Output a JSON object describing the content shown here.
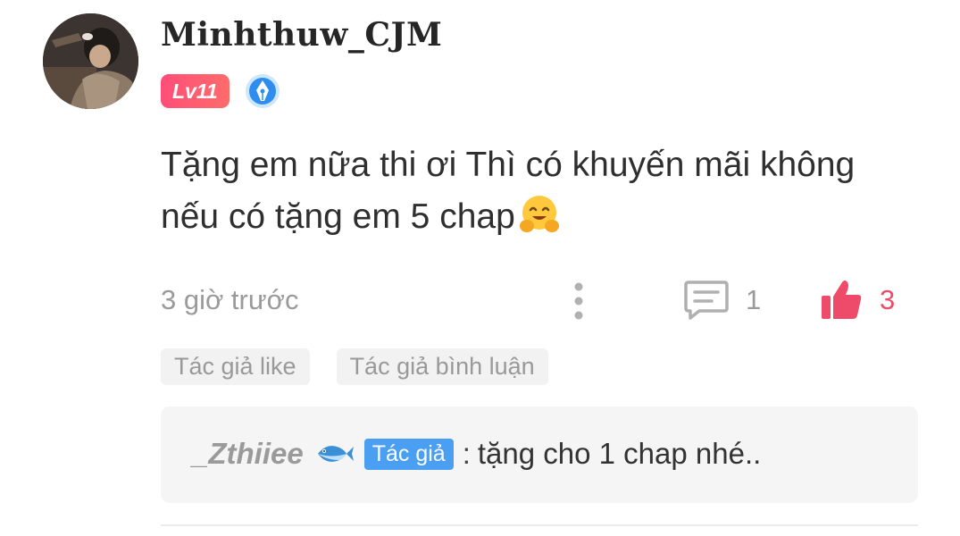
{
  "comment": {
    "username": "Minhthuw_CJM",
    "level_badge": "Lv11",
    "text_line1": "Tặng em nữa thi ơi Thì có khuyến mãi không",
    "text_line2": "nếu có tặng em 5 chap",
    "emoji": "hugging-face-emoji",
    "timestamp": "3 giờ trước",
    "reply_count": "1",
    "like_count": "3"
  },
  "tags": [
    "Tác giả like",
    "Tác giả bình luận"
  ],
  "reply": {
    "username": "_Zthiiee",
    "author_badge": "Tác giả",
    "separator": ":",
    "text": "tặng cho 1 chap nhé.."
  },
  "icons": {
    "pen_badge": "pen-nib-icon",
    "more": "more-vertical-icon",
    "reply": "comment-icon",
    "like": "thumbs-up-icon",
    "fish": "fish-icon"
  },
  "colors": {
    "level_badge": "#ff5577",
    "like": "#ee4b6a",
    "author_badge": "#4a9ff2",
    "muted_text": "#9a9a9a"
  }
}
